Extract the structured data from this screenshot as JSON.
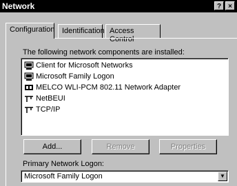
{
  "window": {
    "title": "Network",
    "help_label": "?",
    "close_label": "×"
  },
  "tabs": [
    {
      "label": "Configuration"
    },
    {
      "label": "Identification"
    },
    {
      "label": "Access Control"
    }
  ],
  "components_label": "The following network components are installed:",
  "components": [
    {
      "label": "Client for Microsoft Networks",
      "icon": "client-icon"
    },
    {
      "label": "Microsoft Family Logon",
      "icon": "client-icon"
    },
    {
      "label": "MELCO WLI-PCM 802.11 Network Adapter",
      "icon": "adapter-icon"
    },
    {
      "label": "NetBEUI",
      "icon": "protocol-icon"
    },
    {
      "label": "TCP/IP",
      "icon": "protocol-icon"
    }
  ],
  "buttons": {
    "add": "Add...",
    "remove": "Remove",
    "properties": "Properties"
  },
  "primary_logon": {
    "label": "Primary Network Logon:",
    "value": "Microsoft Family Logon"
  }
}
